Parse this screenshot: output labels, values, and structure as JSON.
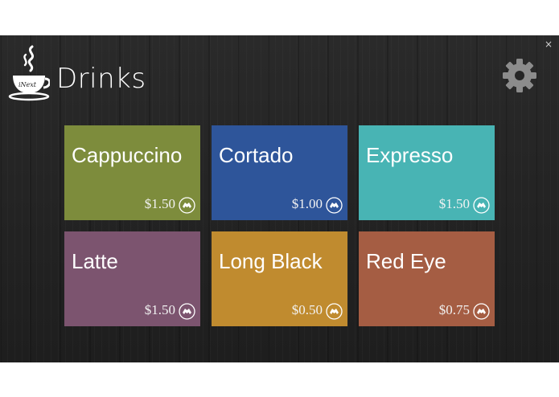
{
  "window": {
    "close_label": "×"
  },
  "header": {
    "title": "Drinks",
    "logo_text": "iNext",
    "logo_icon": "coffee-cup-logo",
    "settings_icon": "gear-icon"
  },
  "colors": {
    "background": "#262626",
    "title": "#ffffff"
  },
  "drinks": [
    {
      "name": "Cappuccino",
      "price": "$1.50",
      "color": "#7d8c3c",
      "icon": "order-icon"
    },
    {
      "name": "Cortado",
      "price": "$1.00",
      "color": "#2e559a",
      "icon": "order-icon"
    },
    {
      "name": "Expresso",
      "price": "$1.50",
      "color": "#48b4b4",
      "icon": "order-icon"
    },
    {
      "name": "Latte",
      "price": "$1.50",
      "color": "#7c546f",
      "icon": "order-icon"
    },
    {
      "name": "Long Black",
      "price": "$0.50",
      "color": "#c08b2f",
      "icon": "order-icon"
    },
    {
      "name": "Red Eye",
      "price": "$0.75",
      "color": "#a55d43",
      "icon": "order-icon"
    }
  ]
}
